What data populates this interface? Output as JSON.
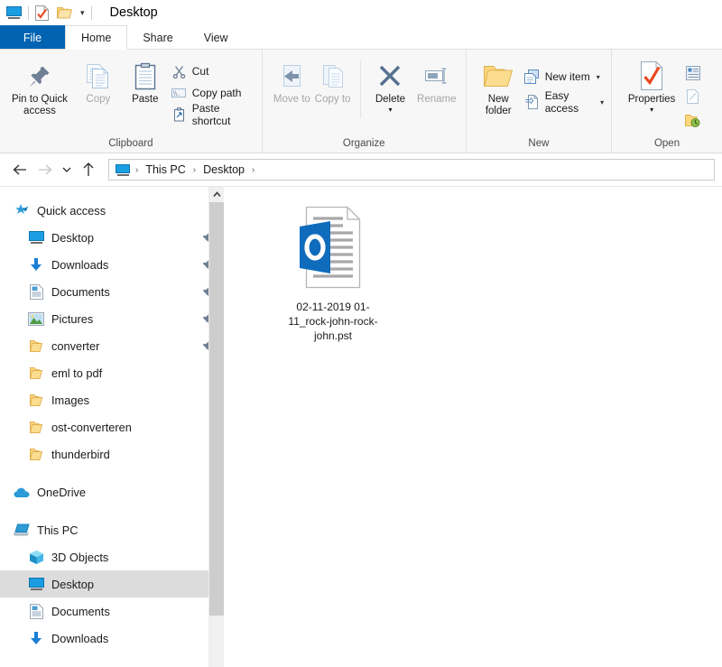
{
  "window": {
    "title": "Desktop",
    "quick_access_icons": [
      "monitor-icon",
      "properties-check-icon",
      "new-folder-icon"
    ],
    "customize_caret": "▾"
  },
  "tabs": [
    {
      "label": "File",
      "id": "file",
      "active": false
    },
    {
      "label": "Home",
      "id": "home",
      "active": true
    },
    {
      "label": "Share",
      "id": "share",
      "active": false
    },
    {
      "label": "View",
      "id": "view",
      "active": false
    }
  ],
  "ribbon": {
    "groups": [
      {
        "label": "Clipboard",
        "big": [
          {
            "label": "Pin to Quick access",
            "icon": "pin-icon",
            "dim": false
          },
          {
            "label": "Copy",
            "icon": "copy-icon",
            "dim": true
          },
          {
            "label": "Paste",
            "icon": "paste-icon",
            "dim": false
          }
        ],
        "small": [
          {
            "label": "Cut",
            "icon": "scissors-icon"
          },
          {
            "label": "Copy path",
            "icon": "copy-path-icon"
          },
          {
            "label": "Paste shortcut",
            "icon": "paste-shortcut-icon"
          }
        ]
      },
      {
        "label": "Organize",
        "big": [
          {
            "label": "Move to",
            "icon": "move-to-icon",
            "caret": "▾",
            "dim": true
          },
          {
            "label": "Copy to",
            "icon": "copy-to-icon",
            "caret": "▾",
            "dim": true
          },
          {
            "label": "Delete",
            "icon": "delete-x-icon",
            "caret": "▾",
            "dim": false
          },
          {
            "label": "Rename",
            "icon": "rename-icon",
            "dim": true
          }
        ]
      },
      {
        "label": "New",
        "big": [
          {
            "label": "New folder",
            "icon": "new-folder-icon",
            "dim": false
          }
        ],
        "small": [
          {
            "label": "New item",
            "icon": "new-item-icon",
            "caret": "▾"
          },
          {
            "label": "Easy access",
            "icon": "easy-access-icon",
            "caret": "▾"
          }
        ]
      },
      {
        "label": "Open",
        "big": [
          {
            "label": "Properties",
            "icon": "properties-check-icon",
            "caret": "▾",
            "dim": false
          }
        ],
        "small": [
          {
            "label": "",
            "icon": "open-with-icon"
          },
          {
            "label": "",
            "icon": "edit-icon"
          },
          {
            "label": "",
            "icon": "history-icon"
          }
        ]
      }
    ]
  },
  "addressbar": {
    "back": "←",
    "forward": "→",
    "recent": "˅",
    "up": "↑",
    "crumbs": [
      "This PC",
      "Desktop"
    ],
    "separator": "›"
  },
  "navpane": {
    "sections": [
      {
        "header": {
          "label": "Quick access",
          "icon": "star-pin-icon"
        },
        "items": [
          {
            "label": "Desktop",
            "icon": "monitor-icon",
            "pinned": true
          },
          {
            "label": "Downloads",
            "icon": "download-icon",
            "pinned": true
          },
          {
            "label": "Documents",
            "icon": "documents-icon",
            "pinned": true
          },
          {
            "label": "Pictures",
            "icon": "pictures-icon",
            "pinned": true
          },
          {
            "label": "converter",
            "icon": "folder-icon",
            "pinned": true
          },
          {
            "label": "eml to pdf",
            "icon": "folder-icon",
            "pinned": false
          },
          {
            "label": "Images",
            "icon": "folder-icon",
            "pinned": false
          },
          {
            "label": "ost-converteren",
            "icon": "folder-icon",
            "pinned": false
          },
          {
            "label": "thunderbird",
            "icon": "folder-icon",
            "pinned": false
          }
        ]
      },
      {
        "header": {
          "label": "OneDrive",
          "icon": "cloud-icon"
        },
        "items": []
      },
      {
        "header": {
          "label": "This PC",
          "icon": "this-pc-icon"
        },
        "items": [
          {
            "label": "3D Objects",
            "icon": "3d-objects-icon",
            "pinned": false,
            "selected": false
          },
          {
            "label": "Desktop",
            "icon": "monitor-icon",
            "pinned": false,
            "selected": true
          },
          {
            "label": "Documents",
            "icon": "documents-icon",
            "pinned": false,
            "selected": false
          },
          {
            "label": "Downloads",
            "icon": "download-icon",
            "pinned": false,
            "selected": false
          }
        ]
      }
    ],
    "pin_glyph": "📌"
  },
  "files": [
    {
      "name": "02-11-2019 01-11_rock-john-rock-john.pst",
      "icon": "outlook-pst-icon",
      "selected": false
    }
  ],
  "colors": {
    "file_tab_blue": "#0063b1",
    "outlook_blue": "#0f6cbd",
    "folder_yellow": "#ffd77a",
    "accent_blue": "#1b9de2",
    "selection_gray": "#dcdcdc",
    "ribbon_bg": "#f7f7f7",
    "scrollbar_thumb": "#cdcdcd",
    "check_orange": "#e8491f"
  }
}
